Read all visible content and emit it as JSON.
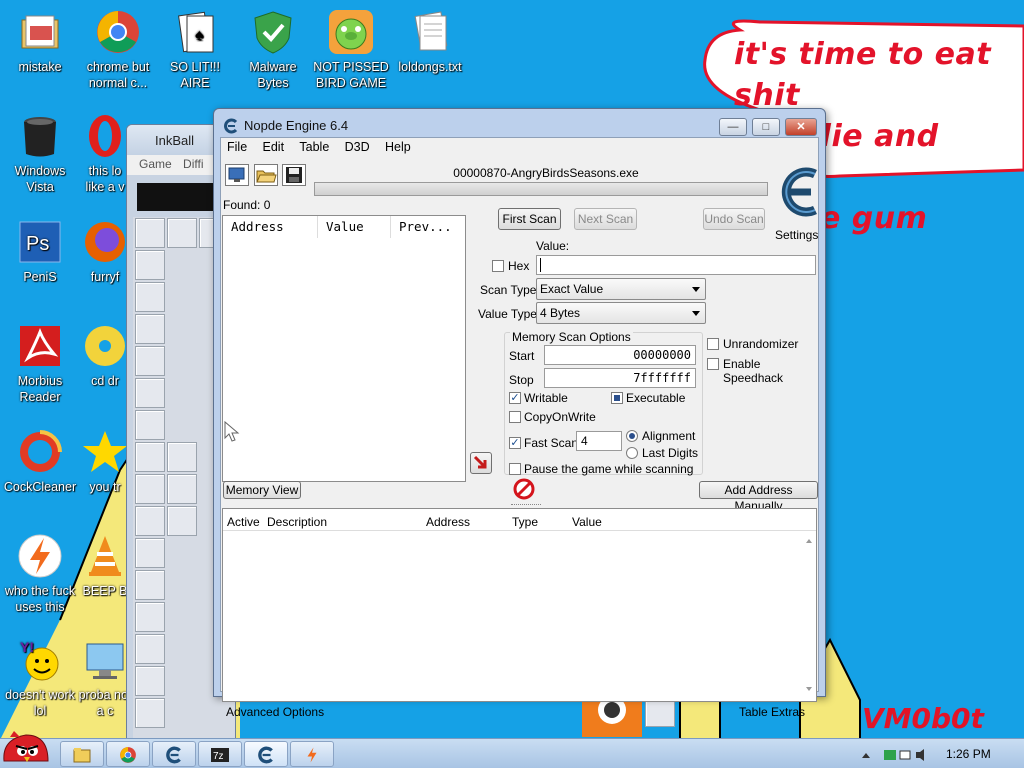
{
  "wallpaper": {
    "speech_lines": [
      "it's time to eat shit",
      "and die and chew",
      "e gum"
    ],
    "signature": "VM0b0t"
  },
  "desktop_icons": [
    {
      "label": "mistake",
      "icon": "folder-icon"
    },
    {
      "label": "chrome but normal c...",
      "icon": "chrome-icon"
    },
    {
      "label": "SO LIT!!! AIRE",
      "icon": "solitaire-icon"
    },
    {
      "label": "Malware Bytes",
      "icon": "shield-icon"
    },
    {
      "label": "NOT PISSED BIRD GAME",
      "icon": "pig-icon"
    },
    {
      "label": "loldongs.txt",
      "icon": "text-file-icon"
    },
    {
      "label": "Windows Vista",
      "icon": "trash-icon"
    },
    {
      "label": "this lo like a v",
      "icon": "opera-icon"
    },
    {
      "label": "PeniS",
      "icon": "photoshop-icon"
    },
    {
      "label": "furryf",
      "icon": "firefox-icon"
    },
    {
      "label": "Morbius Reader",
      "icon": "acrobat-icon"
    },
    {
      "label": "cd dr",
      "icon": "cd-icon"
    },
    {
      "label": "CockCleaner",
      "icon": "ccleaner-icon"
    },
    {
      "label": "you tr",
      "icon": "star-icon"
    },
    {
      "label": "who the fuck uses this",
      "icon": "winamp-icon"
    },
    {
      "label": "BEEP B",
      "icon": "vlc-icon"
    },
    {
      "label": "doesn't work lol",
      "icon": "yahoo-icon"
    },
    {
      "label": "proba not a c",
      "icon": "monitor-icon"
    }
  ],
  "inkball": {
    "title": "InkBall",
    "menu": [
      "Game",
      "Diffi"
    ]
  },
  "window": {
    "title": "Nopde Engine 6.4",
    "buttons": {
      "minimize": "—",
      "maximize": "□",
      "close": "✕"
    },
    "menu": [
      "File",
      "Edit",
      "Table",
      "D3D",
      "Help"
    ],
    "process": "00000870-AngryBirdsSeasons.exe",
    "found": "Found: 0",
    "settings_label": "Settings",
    "results_columns": [
      "Address",
      "Value",
      "Prev..."
    ],
    "buttons_scan": {
      "first": "First Scan",
      "next": "Next Scan",
      "undo": "Undo Scan"
    },
    "value_label": "Value:",
    "hex_label": "Hex",
    "hex_checked": false,
    "value_input": "",
    "scan_type_label": "Scan Type",
    "scan_type_value": "Exact Value",
    "value_type_label": "Value Type",
    "value_type_value": "4 Bytes",
    "memory_options": {
      "title": "Memory Scan Options",
      "start_label": "Start",
      "start_value": "00000000",
      "stop_label": "Stop",
      "stop_value": "7fffffff",
      "writable_label": "Writable",
      "writable_checked": true,
      "executable_label": "Executable",
      "executable_state": "partial",
      "copyonwrite_label": "CopyOnWrite",
      "copyonwrite_checked": false,
      "fastscan_label": "Fast Scan",
      "fastscan_checked": true,
      "fastscan_value": "4",
      "alignment_label": "Alignment",
      "alignment_selected": true,
      "lastdigits_label": "Last Digits",
      "pause_label": "Pause the game while scanning",
      "pause_checked": false
    },
    "unrandomizer_label": "Unrandomizer",
    "unrandomizer_checked": false,
    "speedhack_label": "Enable Speedhack",
    "speedhack_checked": false,
    "memory_view_label": "Memory View",
    "add_address_label": "Add Address Manually",
    "table_columns": [
      "Active",
      "Description",
      "Address",
      "Type",
      "Value"
    ],
    "advanced_options": "Advanced Options",
    "table_extras": "Table Extras"
  },
  "taskbar": {
    "items": [
      "explorer-icon",
      "chrome-icon",
      "cheatengine-icon",
      "7zip-icon",
      "cheatengine-icon",
      "winamp-icon"
    ],
    "time": "1:26 PM"
  },
  "colors": {
    "desktop": "#15a1e6",
    "speech_text": "#e3132a",
    "window_frame": "#bcd0ec"
  }
}
